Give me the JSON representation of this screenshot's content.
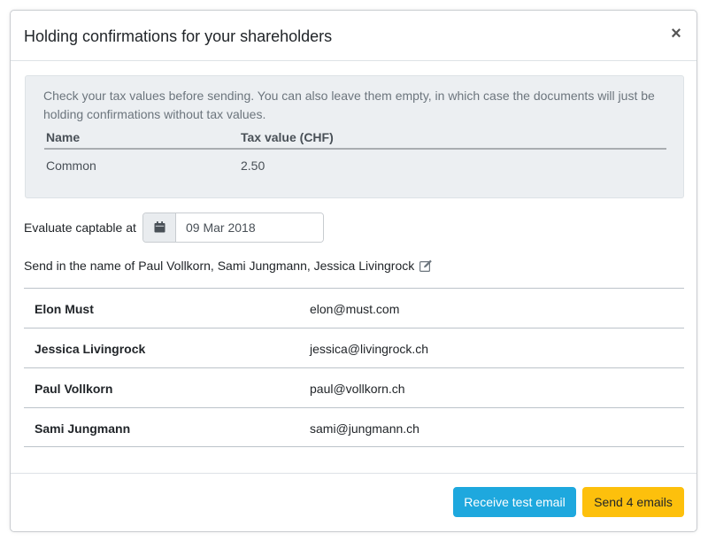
{
  "modal": {
    "title": "Holding confirmations for your shareholders",
    "close_label": "×"
  },
  "info": {
    "text": "Check your tax values before sending. You can also leave them empty, in which case the documents will just be holding confirmations without tax values.",
    "table": {
      "headers": [
        "Name",
        "Tax value (CHF)"
      ],
      "rows": [
        [
          "Common",
          "2.50"
        ]
      ]
    }
  },
  "evaluate": {
    "label": "Evaluate captable at",
    "date_value": "09 Mar 2018",
    "icon": "calendar-icon"
  },
  "send_in_name": {
    "text": "Send in the name of Paul Vollkorn, Sami Jungmann, Jessica Livingrock",
    "icon": "edit-icon"
  },
  "recipients": [
    {
      "name": "Elon Must",
      "email": "elon@must.com"
    },
    {
      "name": "Jessica Livingrock",
      "email": "jessica@livingrock.ch"
    },
    {
      "name": "Paul Vollkorn",
      "email": "paul@vollkorn.ch"
    },
    {
      "name": "Sami Jungmann",
      "email": "sami@jungmann.ch"
    }
  ],
  "footer": {
    "test_button": "Receive test email",
    "send_button": "Send 4 emails"
  },
  "colors": {
    "info_background": "#eceff2",
    "test_button": "#1ea8de",
    "send_button": "#fdc00c"
  }
}
